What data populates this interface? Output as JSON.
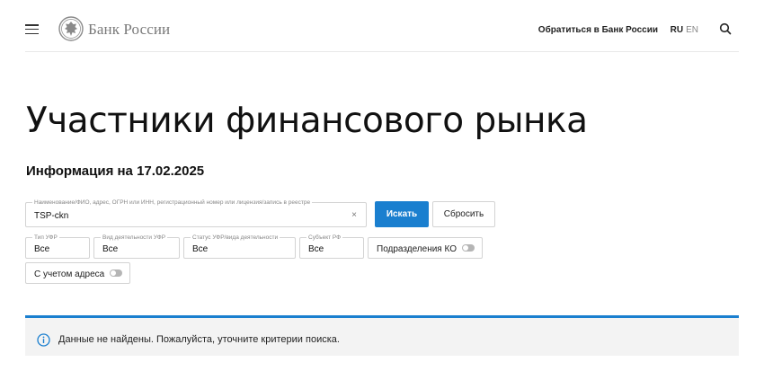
{
  "header": {
    "logo_text": "Банк России",
    "contact_link": "Обратиться в Банк России",
    "lang_active": "RU",
    "lang_inactive": "EN"
  },
  "page": {
    "title": "Участники финансового рынка",
    "info_date": "Информация на 17.02.2025"
  },
  "search": {
    "main_field": {
      "legend": "Наименование/ФИО, адрес, ОГРН или ИНН, регистрационный номер или лицензия/запись в реестре",
      "value": "TSP-ckn",
      "clear_icon": "×"
    },
    "search_button": "Искать",
    "reset_button": "Сбросить"
  },
  "filters": {
    "type_ufr": {
      "legend": "Тип УФР",
      "value": "Все"
    },
    "activity_ufr": {
      "legend": "Вид деятельности УФР",
      "value": "Все"
    },
    "status_ufr": {
      "legend": "Статус УФР/вида деятельности",
      "value": "Все"
    },
    "subject_rf": {
      "legend": "Субъект РФ",
      "value": "Все"
    },
    "ko_subdivisions": {
      "label": "Подразделения КО",
      "on": false
    },
    "with_address": {
      "label": "С учетом адреса",
      "on": false
    }
  },
  "alert": {
    "icon": "info-icon",
    "text": "Данные не найдены. Пожалуйста, уточните критерии поиска."
  },
  "colors": {
    "accent": "#1a7fcf",
    "alert_bg": "#f3f3f3",
    "border": "#d3d3d3"
  }
}
